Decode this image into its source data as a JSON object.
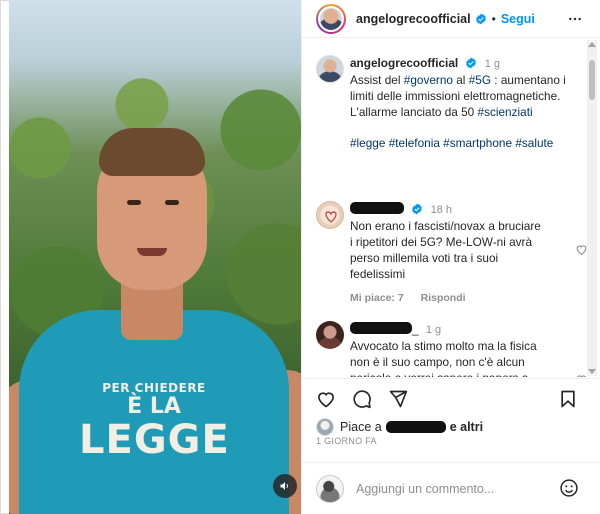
{
  "post": {
    "username": "angelogrecoofficial",
    "follow_label": "Segui",
    "separator": "•"
  },
  "video": {
    "shirt_text_line1": "PER CHIEDERE",
    "shirt_text_line2": "È LA",
    "shirt_text_line3": "LEGGE",
    "sound_icon": "speaker-icon"
  },
  "caption": {
    "username": "angelogrecoofficial",
    "time": "1 g",
    "text_parts": [
      {
        "t": "Assist del ",
        "tag": false
      },
      {
        "t": "#governo",
        "tag": true
      },
      {
        "t": " al ",
        "tag": false
      },
      {
        "t": "#5G",
        "tag": true
      },
      {
        "t": " : aumentano i limiti delle immissioni elettromagnetiche. L'allarme lanciato da 50 ",
        "tag": false
      },
      {
        "t": "#scienziati",
        "tag": true
      }
    ],
    "hashtags": [
      "#legge",
      "#telefonia",
      "#smartphone",
      "#salute"
    ]
  },
  "comments": [
    {
      "time": "18 h",
      "text": "Non erano i fascisti/novax a bruciare i ripetitori dei 5G? Me-LOW-ni avrà perso millemila voti tra i suoi fedelissimi",
      "likes_label": "Mi piace: 7",
      "reply_label": "Rispondi"
    },
    {
      "username_fragment": "_",
      "time": "1 g",
      "text": "Avvocato la stimo molto ma la fisica non è il suo campo, non c'è alcun pericolo e vorrei sapere i papers a"
    }
  ],
  "likes": {
    "prefix": "Piace a",
    "suffix": "e altri"
  },
  "time_ago": "1 GIORNO FA",
  "add_comment": {
    "placeholder": "Aggiungi un commento..."
  },
  "colors": {
    "link_blue": "#0095f6",
    "hashtag": "#00376b",
    "muted": "#8e8e8e",
    "shirt": "#1f9bb8"
  }
}
